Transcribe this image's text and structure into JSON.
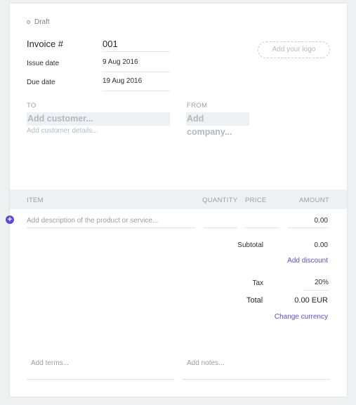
{
  "status": {
    "label": "Draft"
  },
  "invoice": {
    "number_label": "Invoice #",
    "number": "001",
    "issue_date_label": "Issue date",
    "issue_date": "9 Aug 2016",
    "due_date_label": "Due date",
    "due_date": "19 Aug 2016",
    "logo_placeholder": "Add your logo"
  },
  "to": {
    "label": "TO",
    "customer_placeholder": "Add customer...",
    "details_placeholder": "Add customer details..."
  },
  "from": {
    "label": "FROM",
    "company_placeholder": "Add company..."
  },
  "items": {
    "columns": {
      "item": "ITEM",
      "quantity": "QUANTITY",
      "price": "PRICE",
      "amount": "AMOUNT"
    },
    "rows": [
      {
        "description_placeholder": "Add description of the product or service...",
        "quantity": "",
        "price": "",
        "amount": "0.00"
      }
    ]
  },
  "summary": {
    "subtotal_label": "Subtotal",
    "subtotal": "0.00",
    "add_discount": "Add discount",
    "tax_label": "Tax",
    "tax": "20%",
    "total_label": "Total",
    "total": "0.00 EUR",
    "change_currency": "Change currency"
  },
  "footer": {
    "terms_placeholder": "Add terms...",
    "notes_placeholder": "Add notes..."
  },
  "colors": {
    "accent": "#5d4bdc",
    "band": "#eef1f4",
    "background": "#eef0f2"
  }
}
